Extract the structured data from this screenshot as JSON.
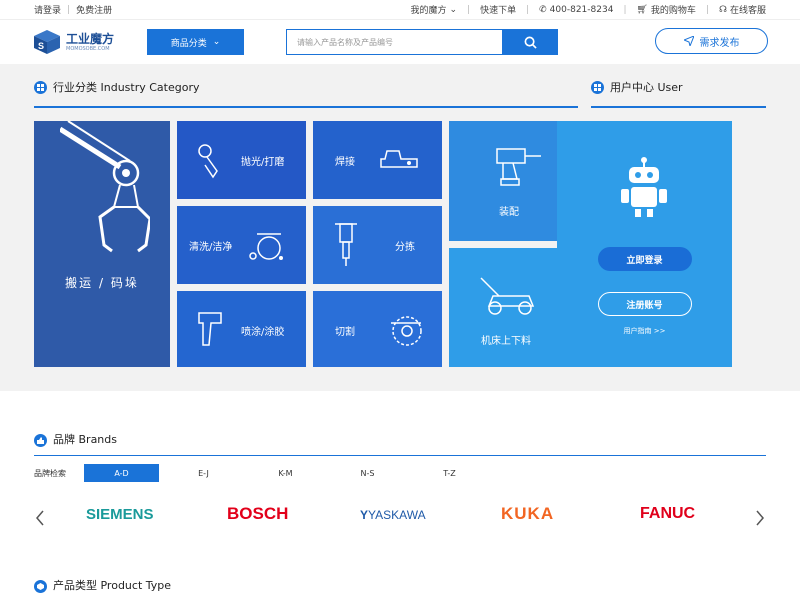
{
  "topbar": {
    "login": "请登录",
    "register": "免费注册",
    "my_mofang": "我的魔方",
    "quick_order": "快速下单",
    "phone": "400-821-8234",
    "cart": "我的购物车",
    "service": "在线客服"
  },
  "header": {
    "logo_cn": "工业魔方",
    "logo_en": "MOMOSOBE.COM",
    "category_btn": "商品分类",
    "search_placeholder": "请输入产品名称及产品编号",
    "demand_btn": "需求发布"
  },
  "industry": {
    "title": "行业分类  Industry  Category",
    "tiles": {
      "move": "搬运 / 码垛",
      "polish": "抛光/打磨",
      "weld": "焊接",
      "assemble": "装配",
      "clean": "清洗/洁净",
      "sort": "分拣",
      "spray": "喷涂/涂胶",
      "cut": "切割",
      "machine": "机床上下料"
    }
  },
  "user_center": {
    "title": "用户中心  User",
    "login_btn": "立即登录",
    "register_btn": "注册账号",
    "guide": "用户指南 >>"
  },
  "brands": {
    "title": "品牌  Brands",
    "filter_label": "品牌检索",
    "tabs": [
      "A-D",
      "E-J",
      "K-M",
      "N-S",
      "T-Z"
    ],
    "active_tab": "A-D",
    "logos": [
      "SIEMENS",
      "BOSCH",
      "YASKAWA",
      "KUKA",
      "FANUC"
    ]
  },
  "product_type": {
    "title": "产品类型  Product Type"
  },
  "colors": {
    "primary": "#1a73d8",
    "tile_dark": "#2f5aa8",
    "tile_mid": "#2462c8",
    "tile_light": "#2f9de8",
    "siemens": "#1a9a9a",
    "bosch": "#e2001a",
    "yaskawa": "#1f5aa8",
    "kuka": "#f26522",
    "fanuc": "#e0001b"
  }
}
